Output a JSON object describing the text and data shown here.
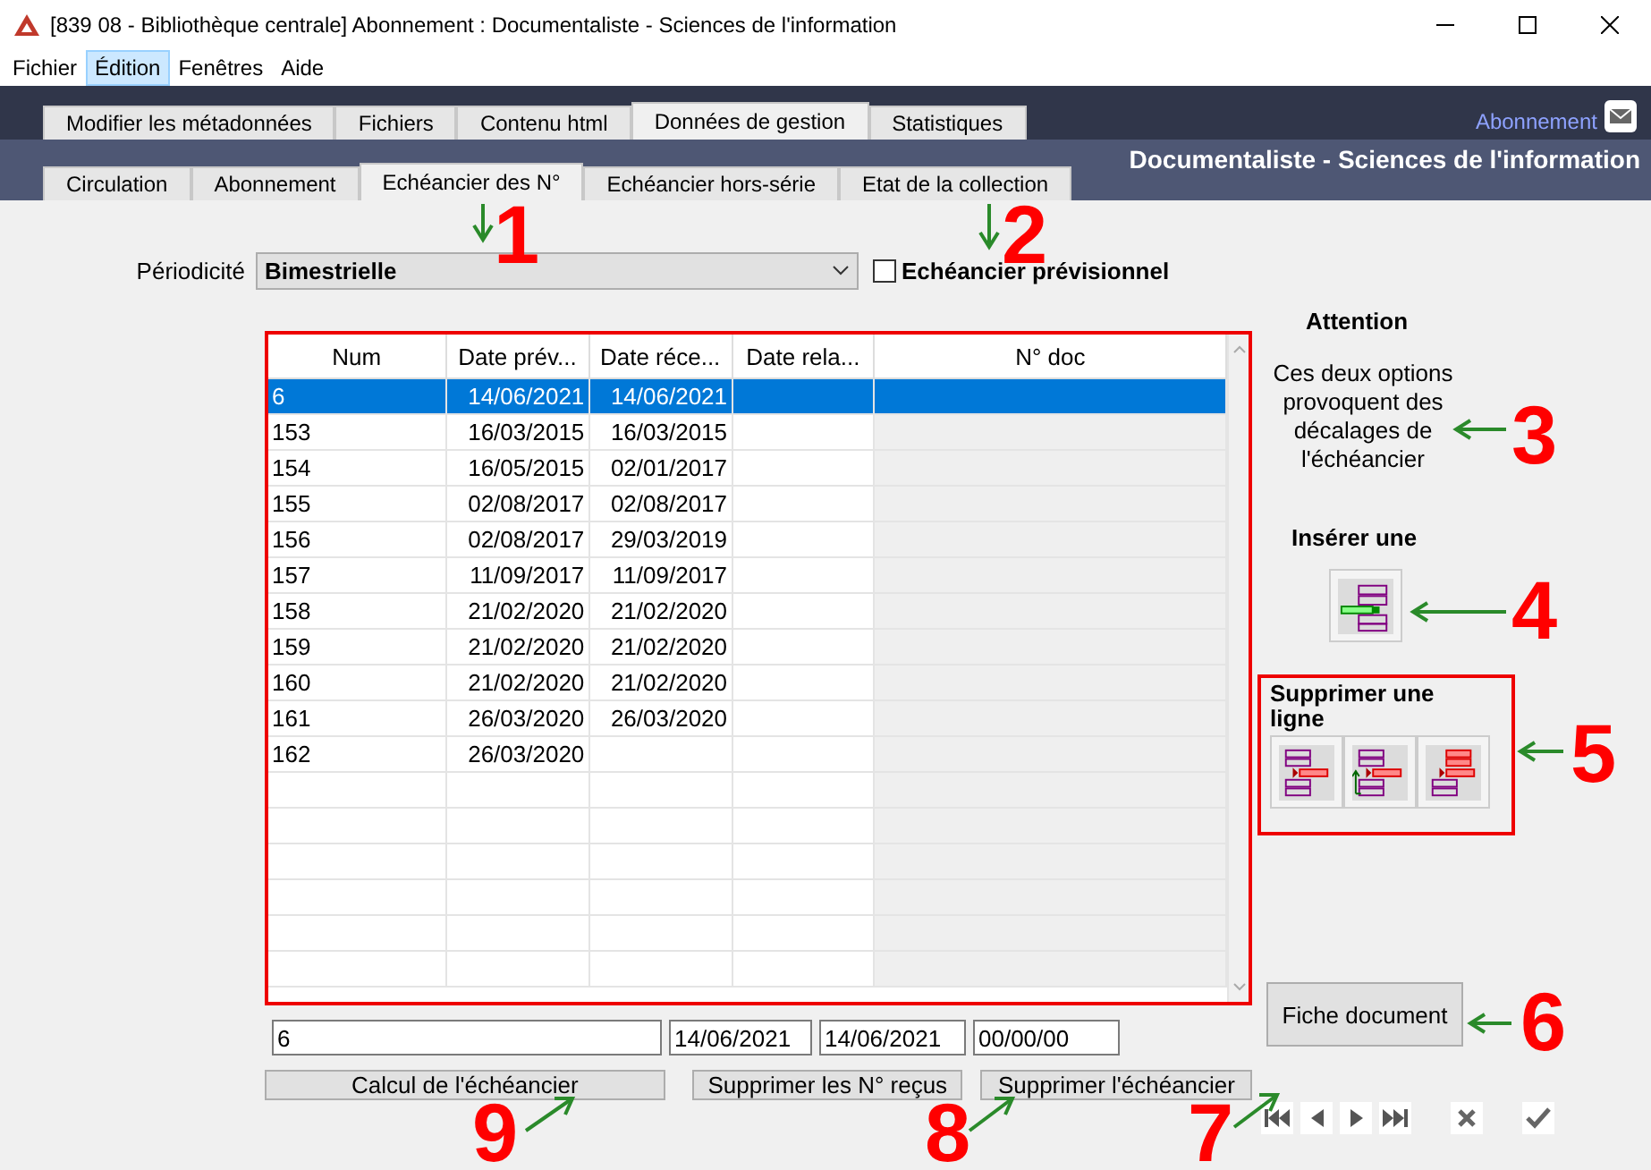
{
  "window": {
    "title": "[839 08 - Bibliothèque centrale] Abonnement : Documentaliste - Sciences de l'information"
  },
  "menu": [
    {
      "label": "Fichier",
      "selected": false
    },
    {
      "label": "Édition",
      "selected": true
    },
    {
      "label": "Fenêtres",
      "selected": false
    },
    {
      "label": "Aide",
      "selected": false
    }
  ],
  "header": {
    "module": "Abonnement",
    "context": "Documentaliste - Sciences de l'information"
  },
  "main_tabs": [
    {
      "label": "Modifier les métadonnées",
      "selected": false
    },
    {
      "label": "Fichiers",
      "selected": false
    },
    {
      "label": "Contenu html",
      "selected": false
    },
    {
      "label": "Données de gestion",
      "selected": true
    },
    {
      "label": "Statistiques",
      "selected": false
    }
  ],
  "sub_tabs": [
    {
      "label": "Circulation",
      "selected": false
    },
    {
      "label": "Abonnement",
      "selected": false
    },
    {
      "label": "Echéancier des N°",
      "selected": true
    },
    {
      "label": "Echéancier hors-série",
      "selected": false
    },
    {
      "label": "Etat de la collection",
      "selected": false
    }
  ],
  "periodicity": {
    "label": "Périodicité",
    "value": "Bimestrielle"
  },
  "forecast_checkbox": {
    "label": "Echéancier prévisionnel",
    "checked": false
  },
  "table": {
    "columns": [
      "Num",
      "Date prév...",
      "Date réce...",
      "Date rela...",
      "N° doc"
    ],
    "rows": [
      {
        "cells": [
          "6",
          "14/06/2021",
          "14/06/2021",
          "",
          ""
        ],
        "selected": true
      },
      {
        "cells": [
          "153",
          "16/03/2015",
          "16/03/2015",
          "",
          ""
        ],
        "selected": false
      },
      {
        "cells": [
          "154",
          "16/05/2015",
          "02/01/2017",
          "",
          ""
        ],
        "selected": false
      },
      {
        "cells": [
          "155",
          "02/08/2017",
          "02/08/2017",
          "",
          ""
        ],
        "selected": false
      },
      {
        "cells": [
          "156",
          "02/08/2017",
          "29/03/2019",
          "",
          ""
        ],
        "selected": false
      },
      {
        "cells": [
          "157",
          "11/09/2017",
          "11/09/2017",
          "",
          ""
        ],
        "selected": false
      },
      {
        "cells": [
          "158",
          "21/02/2020",
          "21/02/2020",
          "",
          ""
        ],
        "selected": false
      },
      {
        "cells": [
          "159",
          "21/02/2020",
          "21/02/2020",
          "",
          ""
        ],
        "selected": false
      },
      {
        "cells": [
          "160",
          "21/02/2020",
          "21/02/2020",
          "",
          ""
        ],
        "selected": false
      },
      {
        "cells": [
          "161",
          "26/03/2020",
          "26/03/2020",
          "",
          ""
        ],
        "selected": false
      },
      {
        "cells": [
          "162",
          "26/03/2020",
          "",
          "",
          ""
        ],
        "selected": false
      }
    ]
  },
  "side": {
    "warning_title": "Attention",
    "warning_text": "Ces deux options provoquent des décalages de l'échéancier",
    "insert_label": "Insérer une",
    "delete_label": "Supprimer une ligne"
  },
  "edit_fields": [
    "6",
    "14/06/2021",
    "14/06/2021",
    "00/00/00"
  ],
  "buttons": {
    "document": "Fiche document",
    "compute": "Calcul de l'échéancier",
    "delete_received": "Supprimer les N° reçus",
    "delete_schedule": "Supprimer l'échéancier"
  },
  "annotations": [
    "1",
    "2",
    "3",
    "4",
    "5",
    "6",
    "9",
    "8",
    "7"
  ]
}
